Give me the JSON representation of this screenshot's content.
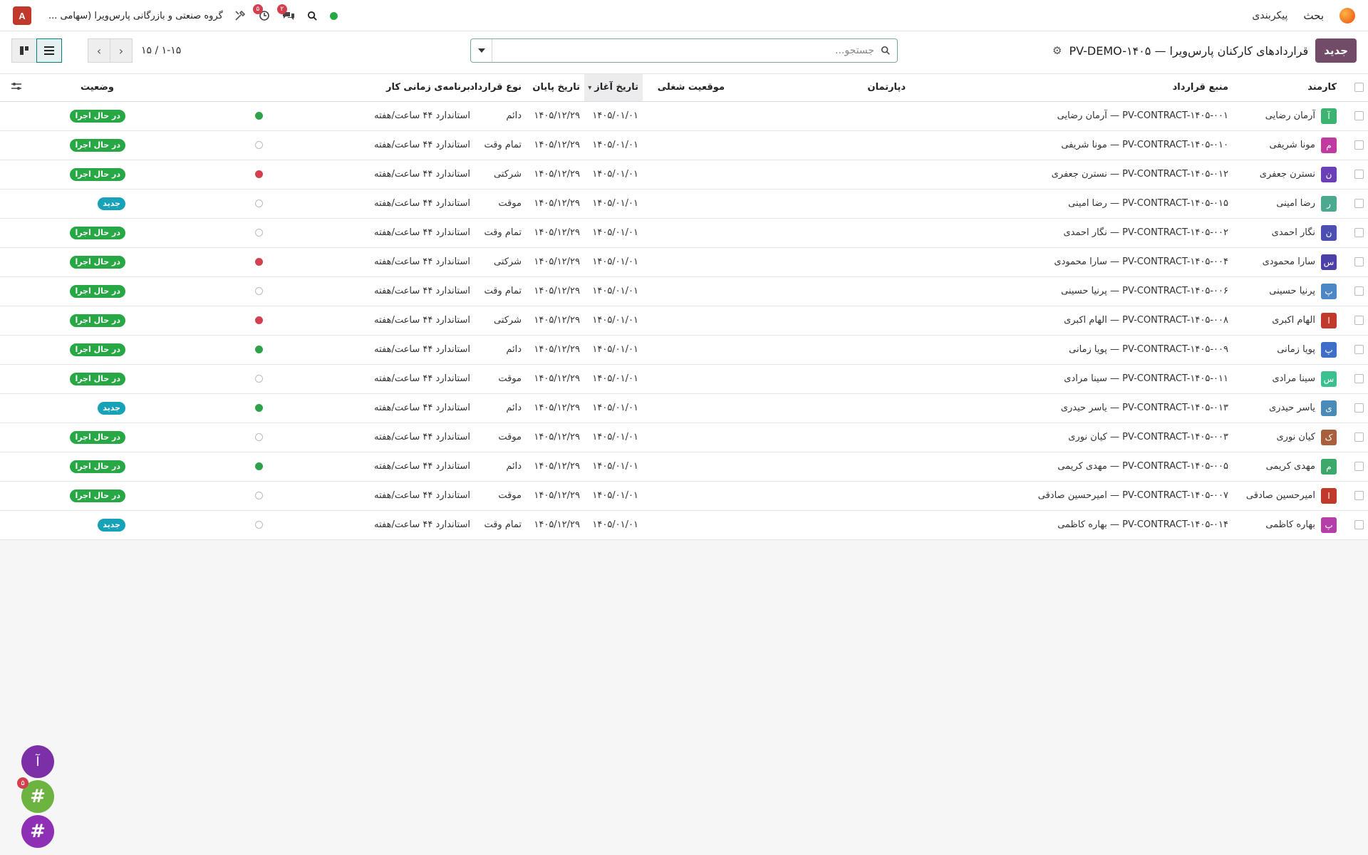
{
  "navbar": {
    "app_name": "بحث",
    "menu_config": "پیکربندی",
    "company": "گروه صنعتی و بازرگانی پارس‌ویرا (سهامی ...",
    "user_initial": "A",
    "activity_badge": "۵",
    "messages_badge": "۲",
    "colors": {
      "avatar": "#c0392b",
      "presence": "#28a745",
      "badge": "#d23f4f"
    }
  },
  "control_panel": {
    "new_label": "جدید",
    "title": "قراردادهای کارکنان پارس‌ویرا — PV-DEMO-۱۴۰۵",
    "search_placeholder": "جستجو...",
    "pager": "۱-۱۵ / ۱۵",
    "accent_color": "#714b67"
  },
  "table": {
    "headers": {
      "employee": "کارمند",
      "reference": "منبع قرارداد",
      "department": "دپارتمان",
      "job": "موقعیت شغلی",
      "start": "تاریخ آغاز",
      "end": "تاریخ پایان",
      "type": "نوع قرارداد",
      "schedule": "برنامه‌ی زمانی کار",
      "status": "وضعیت"
    },
    "rows": [
      {
        "initial": "آ",
        "color": "#3cb371",
        "employee": "آرمان رضایی",
        "reference": "PV-CONTRACT-۱۴۰۵-۰۰۱ — آرمان رضایی",
        "department": "",
        "job": "",
        "start": "۱۴۰۵/۰۱/۰۱",
        "end": "۱۴۰۵/۱۲/۲۹",
        "type": "دائم",
        "schedule": "استاندارد ۴۴ ساعت/هفته",
        "dot": "green",
        "status": "در حال اجرا",
        "status_kind": "running"
      },
      {
        "initial": "م",
        "color": "#c03aa1",
        "employee": "مونا شریفی",
        "reference": "PV-CONTRACT-۱۴۰۵-۰۱۰ — مونا شریفی",
        "department": "",
        "job": "",
        "start": "۱۴۰۵/۰۱/۰۱",
        "end": "۱۴۰۵/۱۲/۲۹",
        "type": "تمام وقت",
        "schedule": "استاندارد ۴۴ ساعت/هفته",
        "dot": "grey",
        "status": "در حال اجرا",
        "status_kind": "running"
      },
      {
        "initial": "ن",
        "color": "#6b3fb5",
        "employee": "نسترن جعفری",
        "reference": "PV-CONTRACT-۱۴۰۵-۰۱۲ — نسترن جعفری",
        "department": "",
        "job": "",
        "start": "۱۴۰۵/۰۱/۰۱",
        "end": "۱۴۰۵/۱۲/۲۹",
        "type": "شرکتی",
        "schedule": "استاندارد ۴۴ ساعت/هفته",
        "dot": "red",
        "status": "در حال اجرا",
        "status_kind": "running"
      },
      {
        "initial": "ر",
        "color": "#4aa98f",
        "employee": "رضا امینی",
        "reference": "PV-CONTRACT-۱۴۰۵-۰۱۵ — رضا امینی",
        "department": "",
        "job": "",
        "start": "۱۴۰۵/۰۱/۰۱",
        "end": "۱۴۰۵/۱۲/۲۹",
        "type": "موقت",
        "schedule": "استاندارد ۴۴ ساعت/هفته",
        "dot": "grey",
        "status": "جدید",
        "status_kind": "new"
      },
      {
        "initial": "ن",
        "color": "#4a4fb0",
        "employee": "نگار احمدی",
        "reference": "PV-CONTRACT-۱۴۰۵-۰۰۲ — نگار احمدی",
        "department": "",
        "job": "",
        "start": "۱۴۰۵/۰۱/۰۱",
        "end": "۱۴۰۵/۱۲/۲۹",
        "type": "تمام وقت",
        "schedule": "استاندارد ۴۴ ساعت/هفته",
        "dot": "grey",
        "status": "در حال اجرا",
        "status_kind": "running"
      },
      {
        "initial": "س",
        "color": "#4b3fa8",
        "employee": "سارا محمودی",
        "reference": "PV-CONTRACT-۱۴۰۵-۰۰۴ — سارا محمودی",
        "department": "",
        "job": "",
        "start": "۱۴۰۵/۰۱/۰۱",
        "end": "۱۴۰۵/۱۲/۲۹",
        "type": "شرکتی",
        "schedule": "استاندارد ۴۴ ساعت/هفته",
        "dot": "red",
        "status": "در حال اجرا",
        "status_kind": "running"
      },
      {
        "initial": "پ",
        "color": "#4c86c4",
        "employee": "پرنیا حسینی",
        "reference": "PV-CONTRACT-۱۴۰۵-۰۰۶ — پرنیا حسینی",
        "department": "",
        "job": "",
        "start": "۱۴۰۵/۰۱/۰۱",
        "end": "۱۴۰۵/۱۲/۲۹",
        "type": "تمام وقت",
        "schedule": "استاندارد ۴۴ ساعت/هفته",
        "dot": "grey",
        "status": "در حال اجرا",
        "status_kind": "running"
      },
      {
        "initial": "ا",
        "color": "#c0392b",
        "employee": "الهام اکبری",
        "reference": "PV-CONTRACT-۱۴۰۵-۰۰۸ — الهام اکبری",
        "department": "",
        "job": "",
        "start": "۱۴۰۵/۰۱/۰۱",
        "end": "۱۴۰۵/۱۲/۲۹",
        "type": "شرکتی",
        "schedule": "استاندارد ۴۴ ساعت/هفته",
        "dot": "red",
        "status": "در حال اجرا",
        "status_kind": "running"
      },
      {
        "initial": "پ",
        "color": "#3d6fc9",
        "employee": "پویا زمانی",
        "reference": "PV-CONTRACT-۱۴۰۵-۰۰۹ — پویا زمانی",
        "department": "",
        "job": "",
        "start": "۱۴۰۵/۰۱/۰۱",
        "end": "۱۴۰۵/۱۲/۲۹",
        "type": "دائم",
        "schedule": "استاندارد ۴۴ ساعت/هفته",
        "dot": "green",
        "status": "در حال اجرا",
        "status_kind": "running"
      },
      {
        "initial": "س",
        "color": "#3cc08f",
        "employee": "سینا مرادی",
        "reference": "PV-CONTRACT-۱۴۰۵-۰۱۱ — سینا مرادی",
        "department": "",
        "job": "",
        "start": "۱۴۰۵/۰۱/۰۱",
        "end": "۱۴۰۵/۱۲/۲۹",
        "type": "موقت",
        "schedule": "استاندارد ۴۴ ساعت/هفته",
        "dot": "grey",
        "status": "در حال اجرا",
        "status_kind": "running"
      },
      {
        "initial": "ی",
        "color": "#4a8ab8",
        "employee": "یاسر حیدری",
        "reference": "PV-CONTRACT-۱۴۰۵-۰۱۳ — یاسر حیدری",
        "department": "",
        "job": "",
        "start": "۱۴۰۵/۰۱/۰۱",
        "end": "۱۴۰۵/۱۲/۲۹",
        "type": "دائم",
        "schedule": "استاندارد ۴۴ ساعت/هفته",
        "dot": "green",
        "status": "جدید",
        "status_kind": "new"
      },
      {
        "initial": "ک",
        "color": "#a8603c",
        "employee": "کیان نوری",
        "reference": "PV-CONTRACT-۱۴۰۵-۰۰۳ — کیان نوری",
        "department": "",
        "job": "",
        "start": "۱۴۰۵/۰۱/۰۱",
        "end": "۱۴۰۵/۱۲/۲۹",
        "type": "موقت",
        "schedule": "استاندارد ۴۴ ساعت/هفته",
        "dot": "grey",
        "status": "در حال اجرا",
        "status_kind": "running"
      },
      {
        "initial": "م",
        "color": "#3ca86a",
        "employee": "مهدی کریمی",
        "reference": "PV-CONTRACT-۱۴۰۵-۰۰۵ — مهدی کریمی",
        "department": "",
        "job": "",
        "start": "۱۴۰۵/۰۱/۰۱",
        "end": "۱۴۰۵/۱۲/۲۹",
        "type": "دائم",
        "schedule": "استاندارد ۴۴ ساعت/هفته",
        "dot": "green",
        "status": "در حال اجرا",
        "status_kind": "running"
      },
      {
        "initial": "ا",
        "color": "#c0392b",
        "employee": "امیرحسین صادقی",
        "reference": "PV-CONTRACT-۱۴۰۵-۰۰۷ — امیرحسین صادقی",
        "department": "",
        "job": "",
        "start": "۱۴۰۵/۰۱/۰۱",
        "end": "۱۴۰۵/۱۲/۲۹",
        "type": "موقت",
        "schedule": "استاندارد ۴۴ ساعت/هفته",
        "dot": "grey",
        "status": "در حال اجرا",
        "status_kind": "running"
      },
      {
        "initial": "پ",
        "color": "#b43fa8",
        "employee": "بهاره کاظمی",
        "reference": "PV-CONTRACT-۱۴۰۵-۰۱۴ — بهاره کاظمی",
        "department": "",
        "job": "",
        "start": "۱۴۰۵/۰۱/۰۱",
        "end": "۱۴۰۵/۱۲/۲۹",
        "type": "تمام وقت",
        "schedule": "استاندارد ۴۴ ساعت/هفته",
        "dot": "grey",
        "status": "جدید",
        "status_kind": "new"
      }
    ]
  },
  "chat_bubbles": [
    {
      "label": "آ",
      "color": "#7d2fa8",
      "badge": ""
    },
    {
      "label": "#",
      "color": "#6db33f",
      "badge": "۵"
    },
    {
      "label": "#",
      "color": "#8e2fb5",
      "badge": ""
    }
  ]
}
